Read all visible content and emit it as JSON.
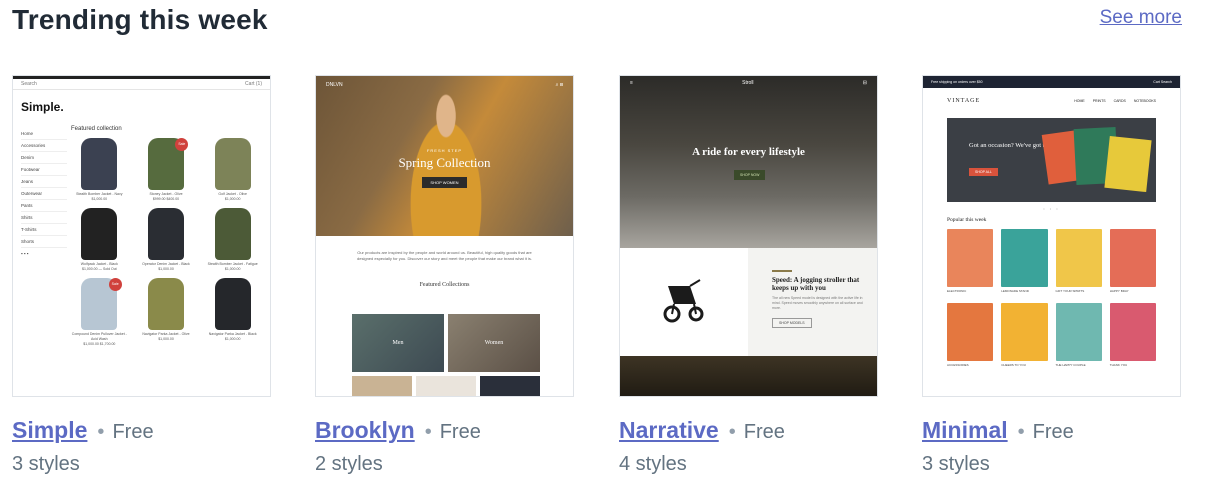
{
  "section": {
    "title": "Trending this week",
    "see_more": "See more"
  },
  "themes": [
    {
      "name": "Simple",
      "separator": "•",
      "price": "Free",
      "styles": "3 styles",
      "preview": {
        "brand": "Simple.",
        "search": "Search",
        "cart": "Cart (1)",
        "heading": "Featured collection",
        "sidebar": [
          "Home",
          "Accessories",
          "Denim",
          "Footwear",
          "Jeans",
          "Outerwear",
          "Pants",
          "Shirts",
          "T-Shirts",
          "Shorts"
        ],
        "sale_badge": "Sale",
        "products": [
          {
            "name": "Stealth Bomber Jacket - Navy",
            "price": "$1,000.00",
            "color": "#3b4151"
          },
          {
            "name": "Stoney Jacket - Olive",
            "price": "$999.00 $400.00",
            "color": "#566b3e",
            "sale": true
          },
          {
            "name": "Golf Jacket - Olive",
            "price": "$1,000.00",
            "color": "#7d8358"
          },
          {
            "name": "Wolfpack Jacket - Black",
            "price": "$1,000.00 — Sold Out",
            "color": "#222222"
          },
          {
            "name": "Operator Denim Jacket - Black",
            "price": "$1,000.00",
            "color": "#2a2d33"
          },
          {
            "name": "Stealth Bomber Jacket - Fatigue",
            "price": "$1,000.00",
            "color": "#4c5a37"
          },
          {
            "name": "Compound Denim Pullover Jacket - Acid Wash",
            "price": "$1,000.00 $1,700.00",
            "color": "#b7c6d3",
            "sale": true
          },
          {
            "name": "Navigator Parka Jacket - Olive",
            "price": "$1,000.00",
            "color": "#8a8a4a"
          },
          {
            "name": "Navigator Parka Jacket - Black",
            "price": "$1,000.00",
            "color": "#25272b"
          }
        ]
      }
    },
    {
      "name": "Brooklyn",
      "separator": "•",
      "price": "Free",
      "styles": "2 styles",
      "preview": {
        "brand": "DNLVN",
        "kicker": "FRESH STEP",
        "hero_title": "Spring Collection",
        "shop_button": "SHOP WOMEN",
        "copy": "Our products are inspired by the people and world around us. Beautiful, high quality goods that are designed especially for you. Discover our story and meet the people that make our brand what it is.",
        "featured": "Featured Collections",
        "tile_labels": [
          "Men",
          "Women"
        ]
      }
    },
    {
      "name": "Narrative",
      "separator": "•",
      "price": "Free",
      "styles": "4 styles",
      "preview": {
        "brand": "Stroll",
        "hero_title": "A ride for every lifestyle",
        "cta": "SHOP NOW",
        "feature_title": "Speed: A jogging stroller that keeps up with you",
        "feature_copy": "The all new Speed model is designed with the active life in mind. Speed moves smoothly anywhere on all surface and more.",
        "feature_button": "SHOP MODELS"
      }
    },
    {
      "name": "Minimal",
      "separator": "•",
      "price": "Free",
      "styles": "3 styles",
      "preview": {
        "promo": "Free shipping on orders over $50",
        "cart": "Cart",
        "search": "Search",
        "logo": "VINTAGE",
        "links": [
          "HOME",
          "PRINTS",
          "CARDS",
          "NOTEBOOKS"
        ],
        "hero_text": "Got an occasion? We've got the card.",
        "hero_button": "SHOP ALL",
        "popular": "Popular this week",
        "products": [
          {
            "name": "ELECTRONIC",
            "color": "#e9855b"
          },
          {
            "name": "LEMONADE STAND",
            "color": "#3aa39a",
            "sale": true
          },
          {
            "name": "GIFT YOUR SPIRITS",
            "color": "#f0c649"
          },
          {
            "name": "HAPPY BDAY",
            "color": "#e46d57"
          },
          {
            "name": "ACCESSORIES",
            "color": "#e4773f"
          },
          {
            "name": "CHEERS TO YOU",
            "color": "#f2b233"
          },
          {
            "name": "THE HAPPY COUPLE",
            "color": "#6fb8b0"
          },
          {
            "name": "THANK YOU",
            "color": "#d95a6f"
          }
        ]
      }
    }
  ]
}
